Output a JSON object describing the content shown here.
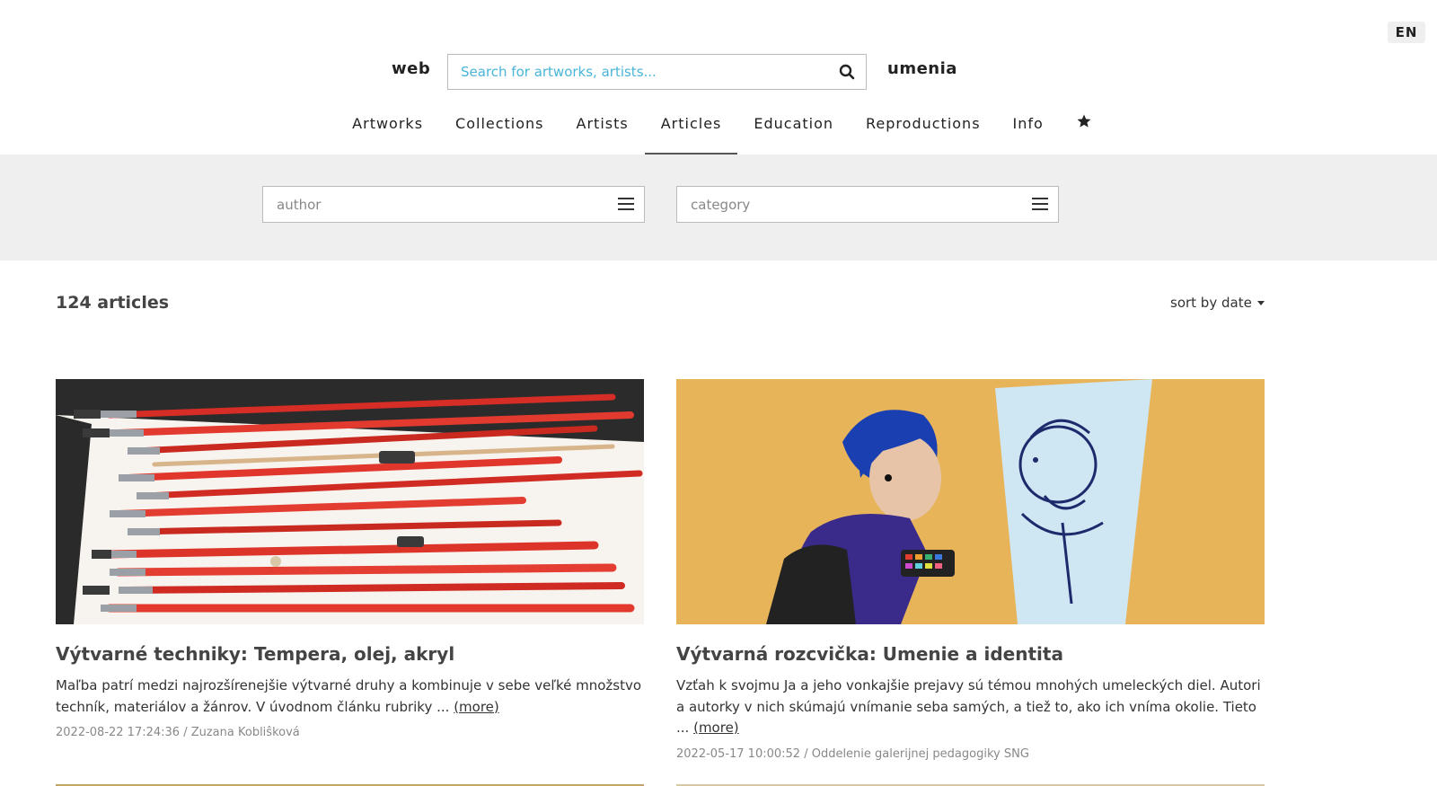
{
  "header": {
    "lang": "EN",
    "brand_left": "web",
    "brand_right": "umenia",
    "search_placeholder": "Search for artworks, artists..."
  },
  "nav": {
    "items": [
      "Artworks",
      "Collections",
      "Artists",
      "Articles",
      "Education",
      "Reproductions",
      "Info"
    ],
    "active": "Articles",
    "favorites_icon": "star-icon"
  },
  "filters": {
    "author_placeholder": "author",
    "category_placeholder": "category"
  },
  "listing": {
    "count_label": "124 articles",
    "sort_label": "sort by date"
  },
  "articles": [
    {
      "title": "Výtvarné techniky: Tempera, olej, akryl",
      "excerpt": "Maľba patrí medzi najrozšírenejšie výtvarné druhy a kombinuje v sebe veľké množstvo techník, materiálov a žánrov. V úvodnom článku rubriky ...",
      "more": "(more)",
      "meta": "2022-08-22 17:24:36 / Zuzana Kobliŝková",
      "image": "paintbrushes-illustration"
    },
    {
      "title": "Výtvarná rozcvička: Umenie a identita",
      "excerpt": "Vzťah k svojmu Ja a jeho vonkajšie prejavy sú témou mnohých umeleckých diel. Autori a autorky v nich skúmajú vnímanie seba samých, a tiež to, ako ich vníma okolie. Tieto ...",
      "more": "(more)",
      "meta": "2022-05-17 10:00:52 / Oddelenie galerijnej pedagogiky SNG",
      "image": "mirror-portrait-illustration"
    }
  ]
}
